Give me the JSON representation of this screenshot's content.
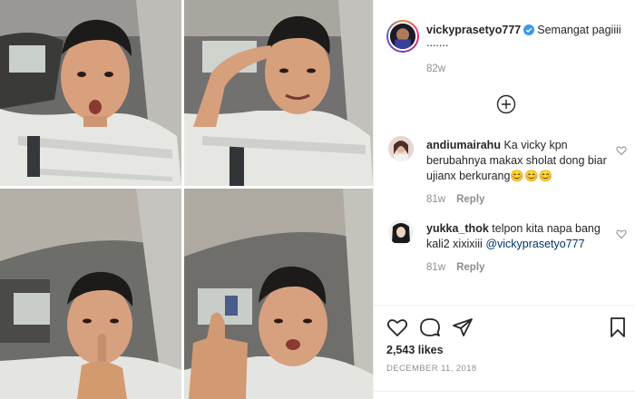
{
  "post": {
    "username": "vickyprasetyo777",
    "caption": "Semangat pagiiii",
    "caption_tail": ".......",
    "age": "82w",
    "likes": "2,543 likes",
    "date": "DECEMBER 11, 2018"
  },
  "comments": [
    {
      "username": "andiumairahu",
      "text": "Ka vicky kpn berubahnya makax sholat dong biar ujianx berkurang",
      "emoji": "😊😊😊",
      "age": "81w",
      "reply_label": "Reply"
    },
    {
      "username": "yukka_thok",
      "text": "telpon kita napa bang kali2 xixixiii",
      "mention": "@vickyprasetyo777",
      "age": "81w",
      "reply_label": "Reply"
    }
  ],
  "icons": {
    "verified": "verified-badge-icon",
    "load_more": "plus-circle-icon",
    "like": "heart-icon",
    "comment": "comment-bubble-icon",
    "share": "paper-plane-icon",
    "save": "bookmark-icon"
  },
  "colors": {
    "text": "#262626",
    "muted": "#8e8e8e",
    "verified": "#3897f0",
    "border": "#efefef"
  }
}
